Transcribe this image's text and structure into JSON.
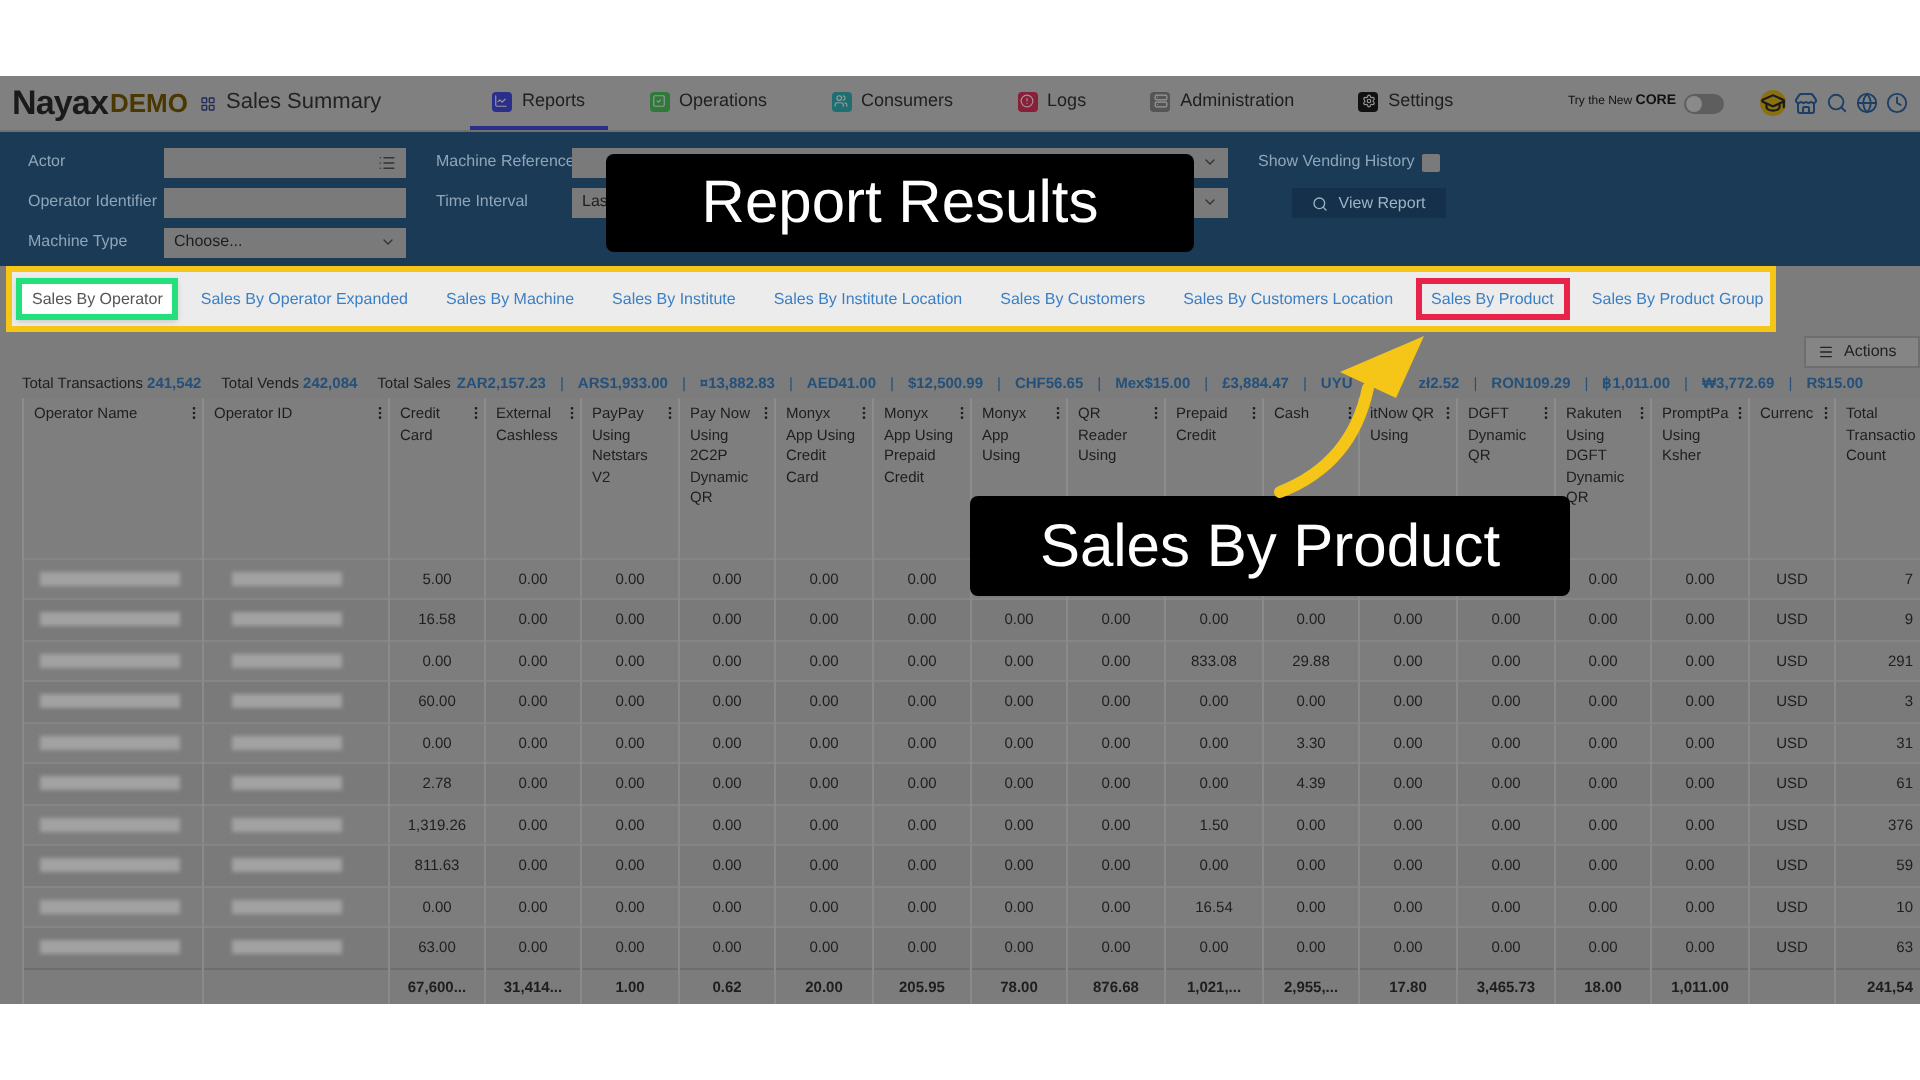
{
  "header": {
    "logo": "Nayax",
    "logo_suffix": "DEMO",
    "page_title": "Sales Summary",
    "nav": [
      {
        "label": "Reports",
        "kind": "reports",
        "selected": true
      },
      {
        "label": "Operations",
        "kind": "operations",
        "selected": false
      },
      {
        "label": "Consumers",
        "kind": "consumers",
        "selected": false
      },
      {
        "label": "Logs",
        "kind": "logs",
        "selected": false
      },
      {
        "label": "Administration",
        "kind": "administration",
        "selected": false
      },
      {
        "label": "Settings",
        "kind": "settings",
        "selected": false
      }
    ],
    "core_toggle": {
      "label": "Try the New",
      "brand": "CORE",
      "on": false
    }
  },
  "filters": {
    "actor": {
      "label": "Actor"
    },
    "operator_identifier": {
      "label": "Operator Identifier"
    },
    "machine_type": {
      "label": "Machine Type",
      "value": "Choose..."
    },
    "machine_reference": {
      "label": "Machine Reference"
    },
    "time_interval": {
      "label": "Time Interval",
      "value": "Las"
    },
    "show_vending_history": {
      "label": "Show Vending History",
      "checked": false
    },
    "view_report_button": "View Report"
  },
  "report_tabs_frame": {
    "color": "#f5c518"
  },
  "report_tabs": [
    {
      "label": "Sales By Operator",
      "selected": true,
      "color": "#22e07a"
    },
    {
      "label": "Sales By Operator Expanded",
      "selected": false
    },
    {
      "label": "Sales By Machine",
      "selected": false
    },
    {
      "label": "Sales By Institute",
      "selected": false
    },
    {
      "label": "Sales By Institute Location",
      "selected": false
    },
    {
      "label": "Sales By Customers",
      "selected": false
    },
    {
      "label": "Sales By Customers Location",
      "selected": false
    },
    {
      "label": "Sales By Product",
      "selected": false,
      "color": "#e8234a"
    },
    {
      "label": "Sales By Product Group",
      "selected": false
    }
  ],
  "actions_button": "Actions",
  "summary": {
    "total_transactions": {
      "label": "Total Transactions",
      "value": "241,542"
    },
    "total_vends": {
      "label": "Total Vends",
      "value": "242,084"
    },
    "total_sales": {
      "label": "Total Sales",
      "separator": "|",
      "values": [
        {
          "text": "ZAR2,157.23",
          "covered_after": false
        },
        {
          "text": "ARS1,933.00",
          "covered_after": false
        },
        {
          "text": "¤13,882.83",
          "covered_after": false
        },
        {
          "text": "AED41.00",
          "covered_after": false
        },
        {
          "text": "$12,500.99",
          "covered_after": false
        },
        {
          "text": "CHF56.65",
          "covered_after": false
        },
        {
          "text": "Mex$15.00",
          "covered_after": false
        },
        {
          "text": "£3,884.47",
          "covered_after": false
        },
        {
          "text": "UYU",
          "covered_after": true
        },
        {
          "text": "zł2.52",
          "covered_after": false
        },
        {
          "text": "RON109.29",
          "covered_after": false
        },
        {
          "text": "฿1,011.00",
          "covered_after": false
        },
        {
          "text": "₩3,772.69",
          "covered_after": false
        },
        {
          "text": "R$15.00",
          "covered_after": false
        }
      ]
    }
  },
  "table": {
    "columns": [
      "Operator Name",
      "Operator ID",
      "Credit Card",
      "External Cashless",
      "PayPay Using Netstars V2",
      "Pay Now Using 2C2P Dynamic QR",
      "Monyx App Using Credit Card",
      "Monyx App Using Prepaid Credit",
      "Monyx App Using",
      "QR Reader Using",
      "Prepaid Credit",
      "Cash",
      "itNow QR Using",
      "DGFT Dynamic QR",
      "Rakuten Using DGFT Dynamic QR",
      "PromptPa Using Ksher",
      "Currenc",
      "Total Transactio Count"
    ],
    "rows": [
      {
        "values": [
          "5.00",
          "0.00",
          "0.00",
          "0.00",
          "0.00",
          "0.00"
        ],
        "values_end": [
          "0.00",
          "0.00",
          "USD",
          "7"
        ]
      },
      {
        "values": [
          "16.58",
          "0.00",
          "0.00",
          "0.00",
          "0.00",
          "0.00",
          "0.00",
          "0.00",
          "0.00",
          "0.00",
          "0.00",
          "0.00",
          "0.00",
          "0.00",
          "USD",
          "9"
        ]
      },
      {
        "values": [
          "0.00",
          "0.00",
          "0.00",
          "0.00",
          "0.00",
          "0.00",
          "0.00",
          "0.00",
          "833.08",
          "29.88",
          "0.00",
          "0.00",
          "0.00",
          "0.00",
          "USD",
          "291"
        ]
      },
      {
        "values": [
          "60.00",
          "0.00",
          "0.00",
          "0.00",
          "0.00",
          "0.00",
          "0.00",
          "0.00",
          "0.00",
          "0.00",
          "0.00",
          "0.00",
          "0.00",
          "0.00",
          "USD",
          "3"
        ]
      },
      {
        "values": [
          "0.00",
          "0.00",
          "0.00",
          "0.00",
          "0.00",
          "0.00",
          "0.00",
          "0.00",
          "0.00",
          "3.30",
          "0.00",
          "0.00",
          "0.00",
          "0.00",
          "USD",
          "31"
        ]
      },
      {
        "values": [
          "2.78",
          "0.00",
          "0.00",
          "0.00",
          "0.00",
          "0.00",
          "0.00",
          "0.00",
          "0.00",
          "4.39",
          "0.00",
          "0.00",
          "0.00",
          "0.00",
          "USD",
          "61"
        ]
      },
      {
        "values": [
          "1,319.26",
          "0.00",
          "0.00",
          "0.00",
          "0.00",
          "0.00",
          "0.00",
          "0.00",
          "1.50",
          "0.00",
          "0.00",
          "0.00",
          "0.00",
          "0.00",
          "USD",
          "376"
        ]
      },
      {
        "values": [
          "811.63",
          "0.00",
          "0.00",
          "0.00",
          "0.00",
          "0.00",
          "0.00",
          "0.00",
          "0.00",
          "0.00",
          "0.00",
          "0.00",
          "0.00",
          "0.00",
          "USD",
          "59"
        ]
      },
      {
        "values": [
          "0.00",
          "0.00",
          "0.00",
          "0.00",
          "0.00",
          "0.00",
          "0.00",
          "0.00",
          "16.54",
          "0.00",
          "0.00",
          "0.00",
          "0.00",
          "0.00",
          "USD",
          "10"
        ]
      },
      {
        "values": [
          "63.00",
          "0.00",
          "0.00",
          "0.00",
          "0.00",
          "0.00",
          "0.00",
          "0.00",
          "0.00",
          "0.00",
          "0.00",
          "0.00",
          "0.00",
          "0.00",
          "USD",
          "63"
        ]
      }
    ],
    "totals": {
      "values": [
        "67,600...",
        "31,414...",
        "1.00",
        "0.62",
        "20.00",
        "205.95",
        "78.00",
        "876.68",
        "1,021,...",
        "2,955,...",
        "17.80",
        "3,465.73",
        "18.00",
        "1,011.00"
      ],
      "values_end": [
        "241,54"
      ]
    }
  },
  "callouts": [
    {
      "kind": "results",
      "text": "Report Results"
    },
    {
      "kind": "product",
      "text": "Sales By Product"
    }
  ]
}
